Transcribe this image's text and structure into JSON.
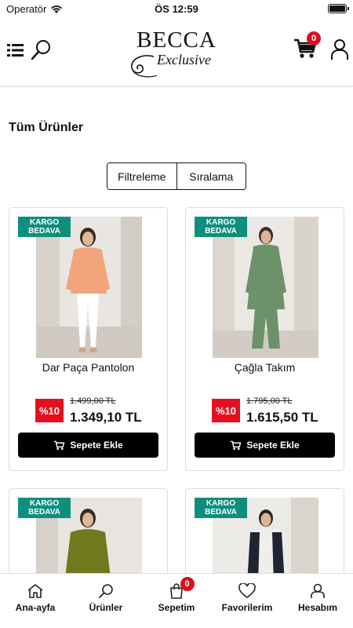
{
  "status_bar": {
    "carrier": "Operatör",
    "time": "ÖS 12:59"
  },
  "header": {
    "logo_brand": "BECCA",
    "logo_sub": "Exclusive",
    "cart_count": "0",
    "icons": [
      "menu-icon",
      "search-icon",
      "cart-icon",
      "user-icon"
    ]
  },
  "page": {
    "title": "Tüm Ürünler",
    "filter_label": "Filtreleme",
    "sort_label": "Sıralama"
  },
  "products": [
    {
      "badge": "KARGO BEDAVA",
      "name": "Dar Paça Pantolon",
      "discount": "%10",
      "old_price": "1.499,00 TL",
      "new_price": "1.349,10 TL",
      "button": "Sepete Ekle",
      "outfit_color": "#f2a57c",
      "pants_color": "#ffffff"
    },
    {
      "badge": "KARGO BEDAVA",
      "name": "Çağla Takım",
      "discount": "%10",
      "old_price": "1.795,00 TL",
      "new_price": "1.615,50 TL",
      "button": "Sepete Ekle",
      "outfit_color": "#6d9168",
      "pants_color": "#6d9168"
    },
    {
      "badge": "KARGO BEDAVA",
      "outfit_color": "#707a1e"
    },
    {
      "badge": "KARGO BEDAVA",
      "outfit_color": "#1f2433"
    }
  ],
  "bottom_nav": [
    {
      "label": "Ana-ayfa",
      "icon": "home-icon"
    },
    {
      "label": "Ürünler",
      "icon": "search-icon"
    },
    {
      "label": "Sepetim",
      "icon": "bag-icon",
      "badge": "0"
    },
    {
      "label": "Favorilerim",
      "icon": "heart-icon"
    },
    {
      "label": "Hesabım",
      "icon": "user-icon"
    }
  ],
  "colors": {
    "accent_red": "#e5101e",
    "badge_green": "#0e8f7e",
    "button_black": "#000000"
  }
}
